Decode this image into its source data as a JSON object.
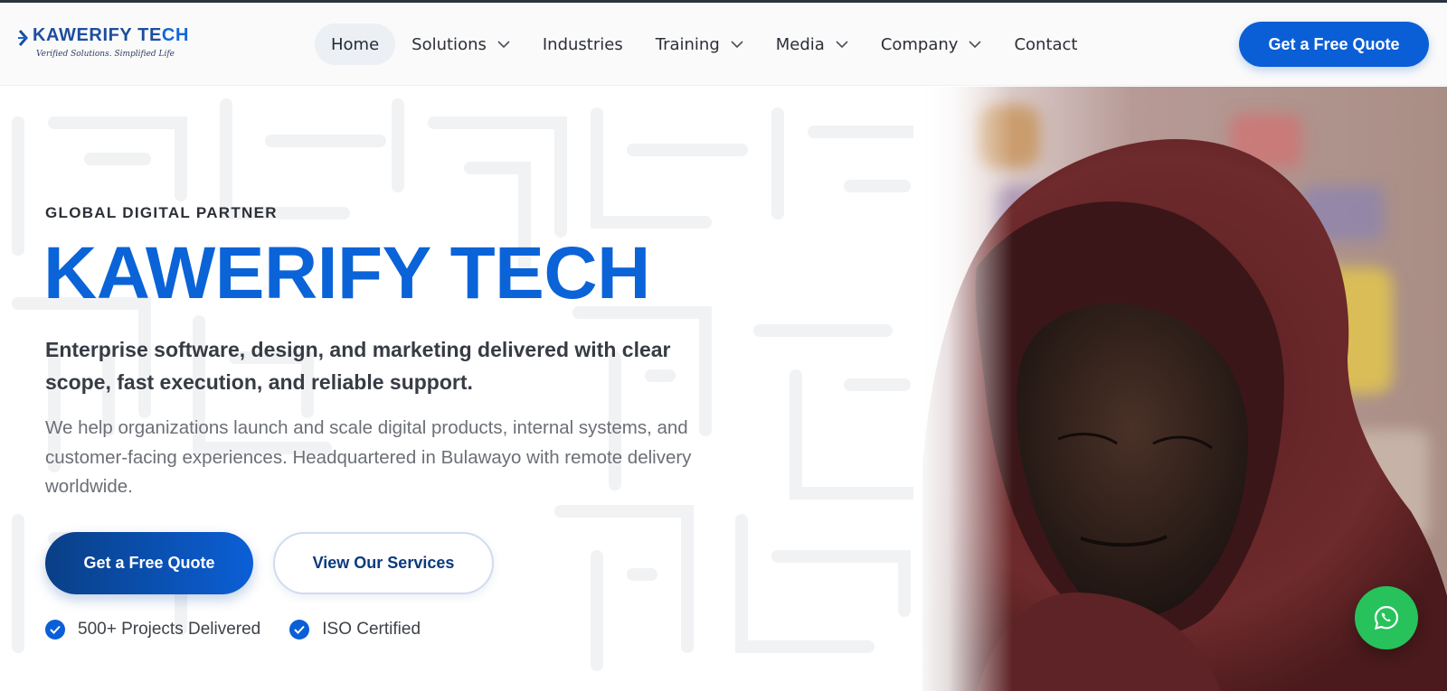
{
  "header": {
    "logo": {
      "name_main": "KAWERIFY TE",
      "name_tail": "CH",
      "tagline": "Verified Solutions. Simplified Life"
    },
    "nav": [
      {
        "label": "Home",
        "active": true,
        "has_dropdown": false
      },
      {
        "label": "Solutions",
        "active": false,
        "has_dropdown": true
      },
      {
        "label": "Industries",
        "active": false,
        "has_dropdown": false
      },
      {
        "label": "Training",
        "active": false,
        "has_dropdown": true
      },
      {
        "label": "Media",
        "active": false,
        "has_dropdown": true
      },
      {
        "label": "Company",
        "active": false,
        "has_dropdown": true
      },
      {
        "label": "Contact",
        "active": false,
        "has_dropdown": false
      }
    ],
    "cta_label": "Get a Free Quote"
  },
  "hero": {
    "eyebrow": "GLOBAL DIGITAL PARTNER",
    "title": "KAWERIFY TECH",
    "subtitle": "Enterprise software, design, and marketing delivered with clear scope, fast execution, and reliable support.",
    "description": "We help organizations launch and scale digital products, internal systems, and customer-facing experiences. Headquartered in Bulawayo with remote delivery worldwide.",
    "primary_button": "Get a Free Quote",
    "secondary_button": "View Our Services",
    "badges": [
      {
        "icon": "check-circle-icon",
        "label": "500+ Projects Delivered"
      },
      {
        "icon": "check-circle-icon",
        "label": "ISO Certified"
      }
    ],
    "image": "person-in-red-hoodie-photo"
  },
  "floating": {
    "whatsapp_icon": "whatsapp-icon"
  },
  "colors": {
    "brand_blue": "#0b63d8",
    "brand_dark": "#0a3f86",
    "whatsapp_green": "#27c25c",
    "text_dark": "#373b44",
    "text_muted": "#6b6f76"
  }
}
